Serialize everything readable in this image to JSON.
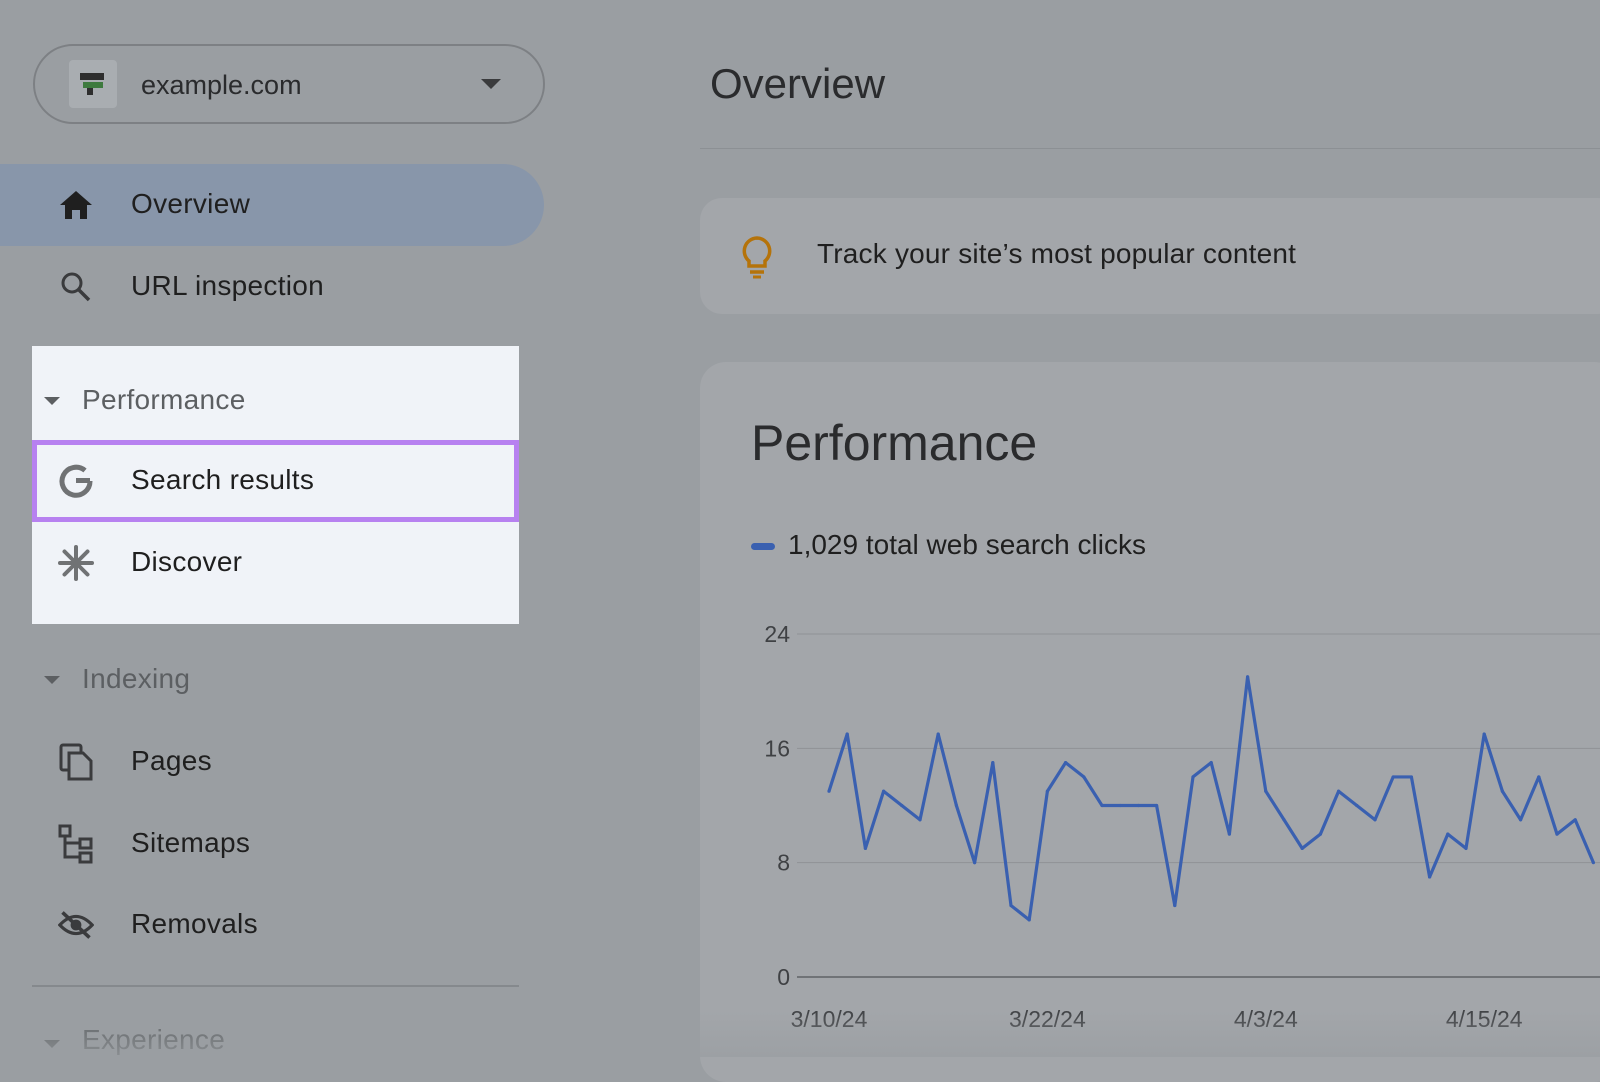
{
  "property": {
    "name": "example.com"
  },
  "nav": {
    "overview": "Overview",
    "url_inspection": "URL inspection",
    "performance_header": "Performance",
    "search_results": "Search results",
    "discover": "Discover",
    "indexing_header": "Indexing",
    "pages": "Pages",
    "sitemaps": "Sitemaps",
    "removals": "Removals",
    "experience_header": "Experience"
  },
  "main": {
    "title": "Overview",
    "tip": "Track your site’s most popular content",
    "performance_title": "Performance"
  },
  "colors": {
    "accent_highlight": "#b781f0",
    "series": "#3a60b0",
    "tip_icon": "#b5730a",
    "active_nav": "#8896aa"
  },
  "icons": [
    "home-icon",
    "search-icon",
    "google-g-icon",
    "discover-asterisk-icon",
    "pages-icon",
    "sitemaps-icon",
    "removals-icon",
    "lightbulb-icon",
    "dropdown-caret-icon"
  ],
  "chart_data": {
    "type": "line",
    "series": [
      {
        "name": "1,029 total web search clicks",
        "values": [
          13,
          17,
          9,
          13,
          12,
          11,
          17,
          12,
          8,
          15,
          5,
          4,
          13,
          15,
          14,
          12,
          12,
          12,
          12,
          5,
          14,
          15,
          10,
          21,
          13,
          11,
          9,
          10,
          13,
          12,
          11,
          14,
          14,
          7,
          10,
          9,
          17,
          13,
          11,
          14,
          10,
          11,
          8
        ]
      }
    ],
    "x_ticks": [
      "3/10/24",
      "3/22/24",
      "4/3/24",
      "4/15/24"
    ],
    "y_ticks": [
      "24",
      "16",
      "8",
      "0"
    ],
    "ylim": [
      0,
      24
    ],
    "grid": true
  }
}
